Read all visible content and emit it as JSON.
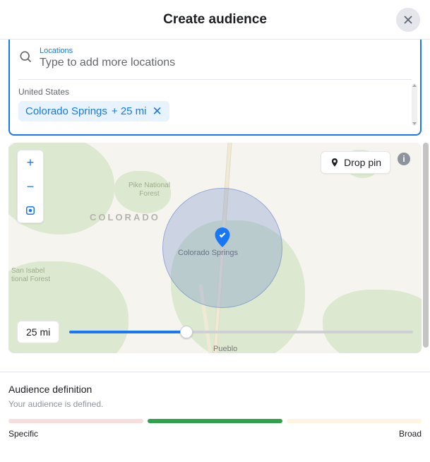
{
  "header": {
    "title": "Create audience"
  },
  "locations": {
    "section_label": "Locations",
    "input_placeholder": "Type to add more locations",
    "country": "United States",
    "chip": {
      "city": "Colorado Springs",
      "radius": "+ 25 mi"
    }
  },
  "map": {
    "zoom_in": "+",
    "zoom_out": "−",
    "drop_pin": "Drop pin",
    "info": "i",
    "labels": {
      "pike": "Pike National\nForest",
      "state": "COLORADO",
      "san_isabel": "San Isabel\ntional Forest",
      "city": "Colorado Springs",
      "pueblo": "Pueblo"
    },
    "radius_display": "25 mi"
  },
  "audience": {
    "title": "Audience definition",
    "subtitle": "Your audience is defined.",
    "specific": "Specific",
    "broad": "Broad"
  }
}
